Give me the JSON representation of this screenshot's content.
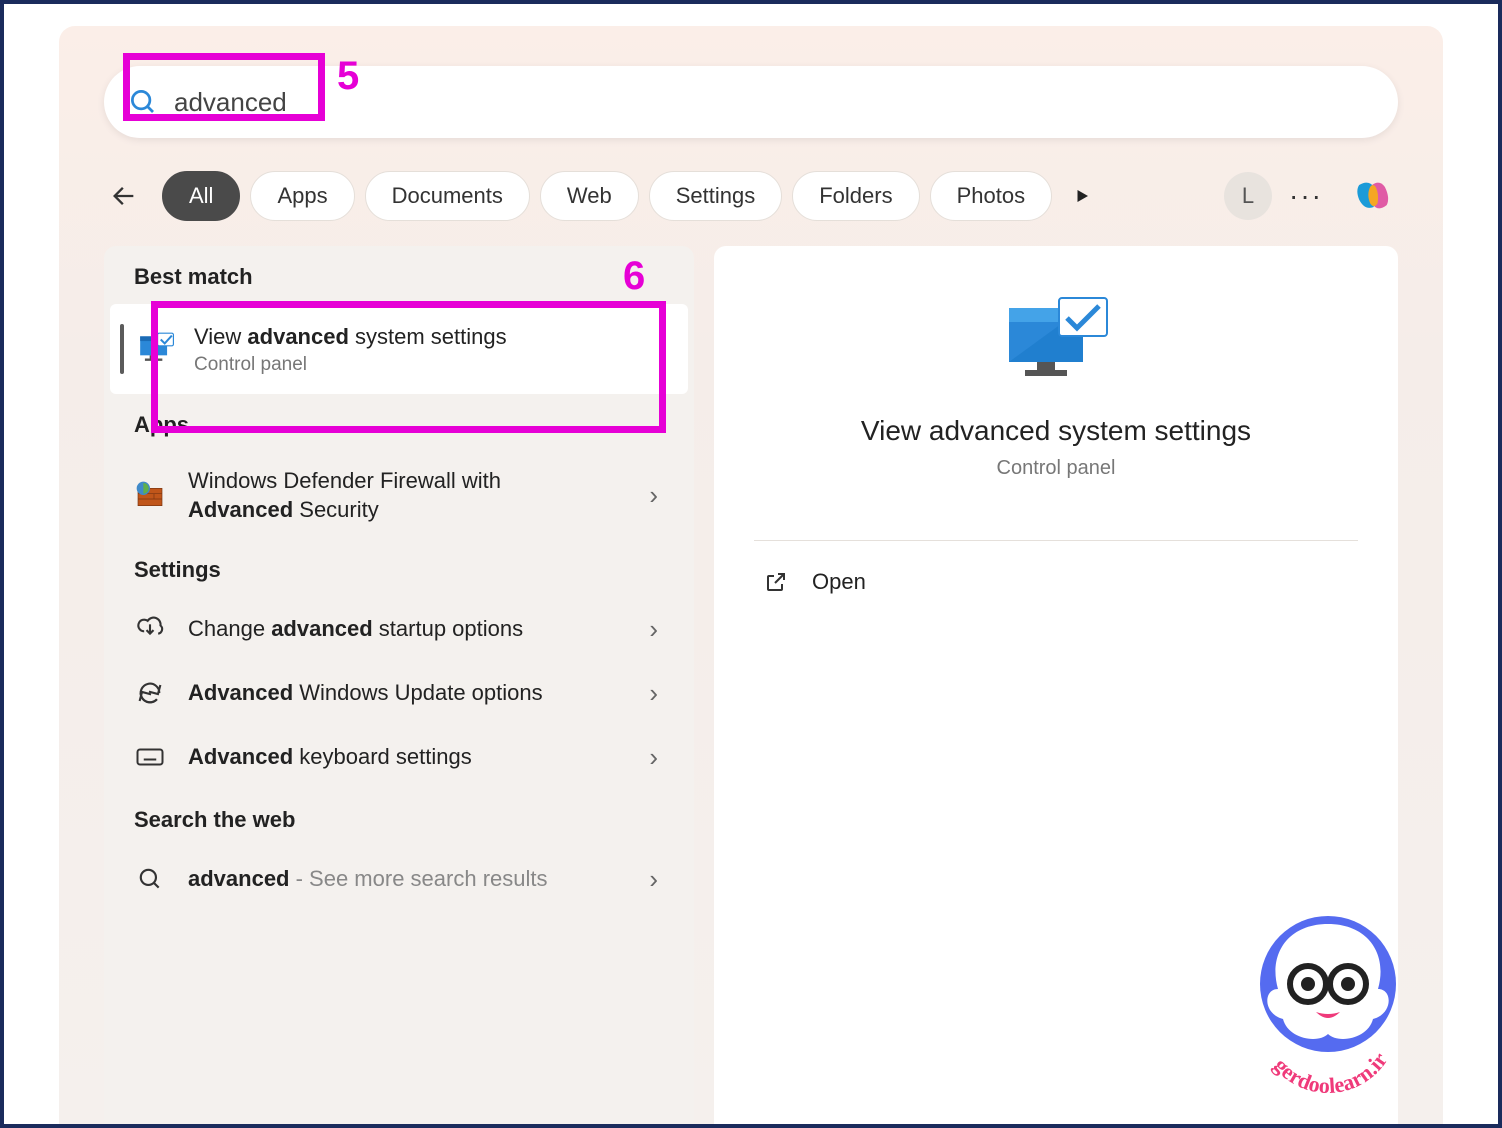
{
  "search": {
    "query": "advanced"
  },
  "annotations": {
    "box1_label": "5",
    "box2_label": "6"
  },
  "filters": {
    "items": [
      "All",
      "Apps",
      "Documents",
      "Web",
      "Settings",
      "Folders",
      "Photos"
    ],
    "active_index": 0
  },
  "header_right": {
    "user_initial": "L",
    "more": "···"
  },
  "results": {
    "best_match_header": "Best match",
    "best_match": {
      "title_pre": "View ",
      "title_bold": "advanced",
      "title_post": " system settings",
      "subtitle": "Control panel"
    },
    "apps_header": "Apps",
    "apps": [
      {
        "line1_pre": "Windows Defender Firewall with ",
        "line2_bold": "Advanced",
        "line2_post": " Security"
      }
    ],
    "settings_header": "Settings",
    "settings": [
      {
        "pre": "Change ",
        "bold": "advanced",
        "post": " startup options"
      },
      {
        "bold": "Advanced",
        "post": " Windows Update options"
      },
      {
        "bold": "Advanced",
        "post": " keyboard settings"
      }
    ],
    "web_header": "Search the web",
    "web": [
      {
        "bold": "advanced",
        "post_gray": " - See more search results"
      }
    ]
  },
  "preview": {
    "title": "View advanced system settings",
    "subtitle": "Control panel",
    "action": "Open"
  },
  "watermark": {
    "text": "gerdoolearn.ir"
  }
}
